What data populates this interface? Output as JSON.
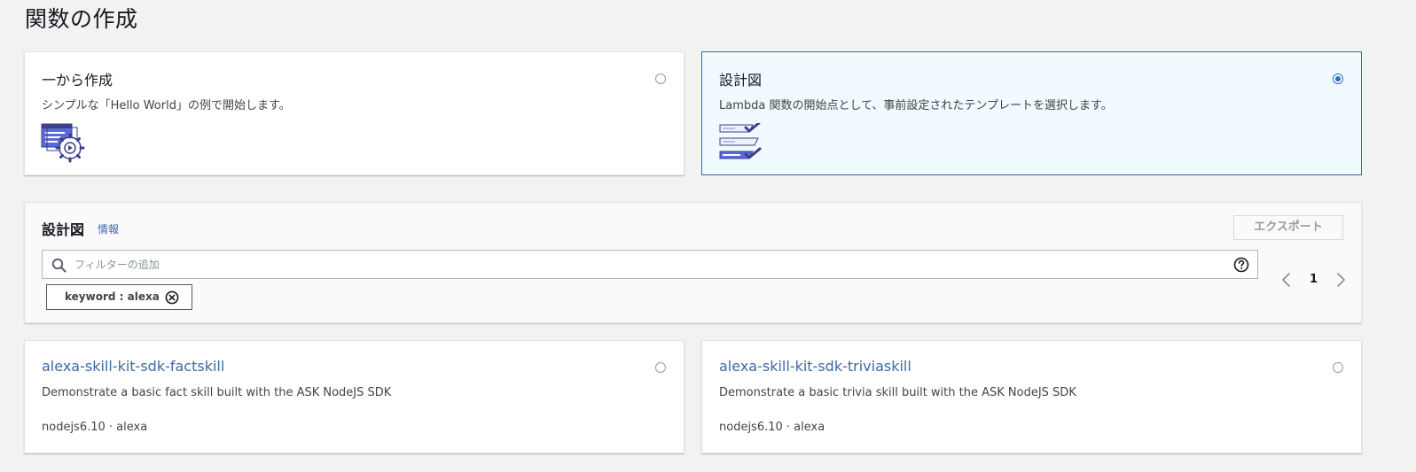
{
  "page": {
    "title": "関数の作成"
  },
  "options": [
    {
      "title": "一から作成",
      "description": "シンプルな「Hello World」の例で開始します。",
      "selected": false
    },
    {
      "title": "設計図",
      "description": "Lambda 関数の開始点として、事前設定されたテンプレートを選択します。",
      "selected": true
    }
  ],
  "blueprints_panel": {
    "title": "設計図",
    "info_link": "情報",
    "export_label": "エクスポート",
    "filter": {
      "placeholder": "フィルターの追加",
      "value": ""
    },
    "token": {
      "label": "keyword : alexa"
    },
    "pagination": {
      "current_page": "1"
    }
  },
  "blueprints": [
    {
      "name": "alexa-skill-kit-sdk-factskill",
      "description": "Demonstrate a basic fact skill built with the ASK NodeJS SDK",
      "meta": "nodejs6.10 · alexa"
    },
    {
      "name": "alexa-skill-kit-sdk-triviaskill",
      "description": "Demonstrate a basic trivia skill built with the ASK NodeJS SDK",
      "meta": "nodejs6.10 · alexa"
    }
  ],
  "colors": {
    "accent": "#3d6aa6",
    "radio_selected": "#2f6db5",
    "selected_bg": "#f1faff"
  },
  "icons": {
    "author_from_scratch": "window-gear-icon",
    "blueprint": "checklist-icon",
    "search": "search-icon",
    "help": "help-icon",
    "token_remove": "close-circle-icon",
    "prev": "chevron-left-icon",
    "next": "chevron-right-icon"
  }
}
